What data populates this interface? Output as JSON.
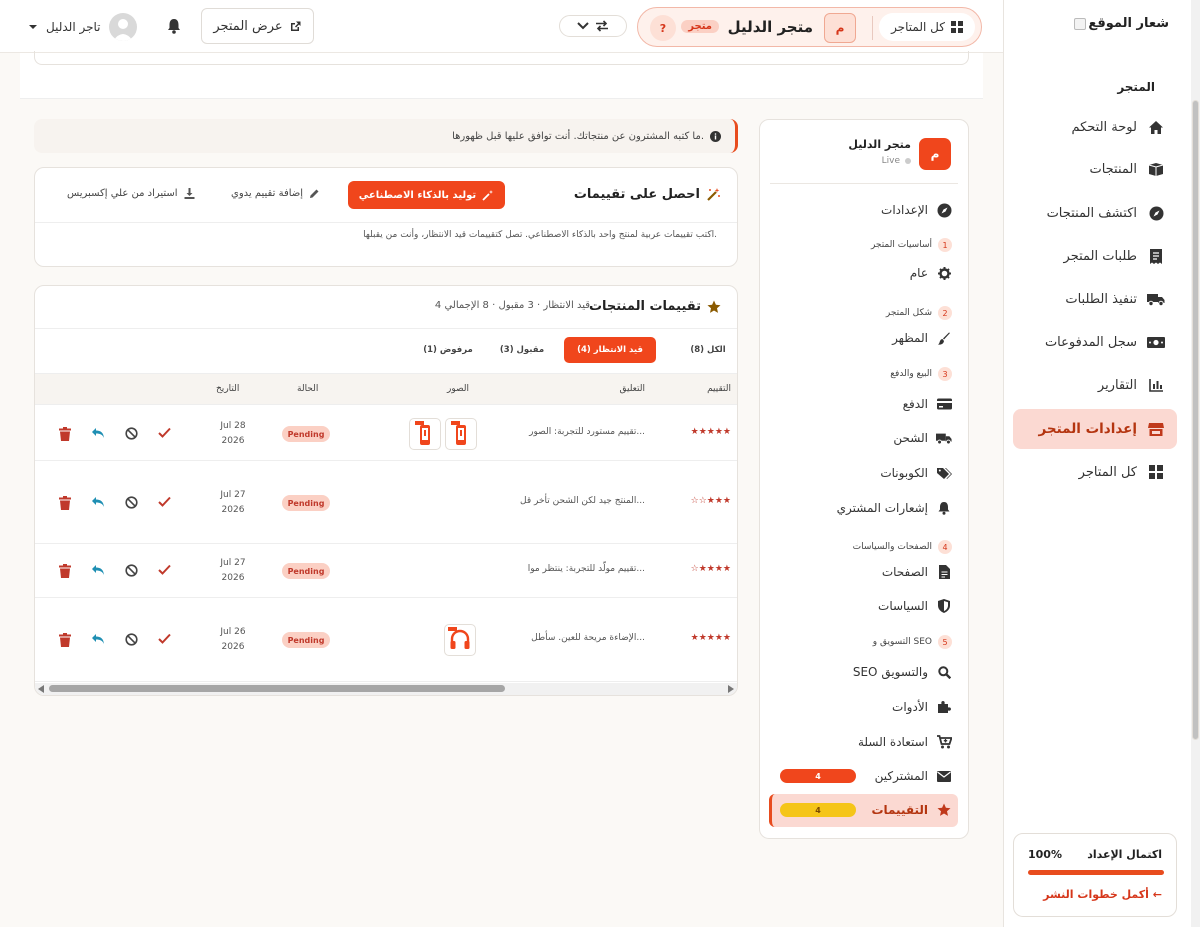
{
  "logo": {
    "text": "شعار الموقع"
  },
  "nav": {
    "section": "المتجر",
    "items": [
      {
        "label": "لوحة التحكم",
        "icon": "home-icon"
      },
      {
        "label": "المنتجات",
        "icon": "box-icon"
      },
      {
        "label": "اكتشف المنتجات",
        "icon": "compass-icon"
      },
      {
        "label": "طلبات المتجر",
        "icon": "receipt-icon"
      },
      {
        "label": "تنفيذ الطلبات",
        "icon": "truck-icon"
      },
      {
        "label": "سجل المدفوعات",
        "icon": "money-icon"
      },
      {
        "label": "التقارير",
        "icon": "chart-icon"
      },
      {
        "label": "إعدادات المتجر",
        "icon": "store-icon"
      },
      {
        "label": "كل المتاجر",
        "icon": "grid-icon"
      }
    ],
    "active_index": 7
  },
  "setup": {
    "title": "اكتمال الإعداد",
    "percent": "100%",
    "progress": 1.0,
    "link": "أكمل خطوات النشر ←"
  },
  "topbar": {
    "user_name": "تاجر الدليل",
    "view_store": "عرض المتجر",
    "all_stores": "كل المتاجر",
    "store_initial": "م",
    "store_name": "متجر الدليل",
    "store_badge": "متجر",
    "help": "?"
  },
  "settings_panel": {
    "store_initial": "م",
    "store_name": "متجر الدليل",
    "status": "Live",
    "items": [
      {
        "type": "item",
        "label": "الإعدادات",
        "icon": "compass-icon"
      },
      {
        "type": "group",
        "num": "1",
        "label": "أساسيات المتجر"
      },
      {
        "type": "item",
        "label": "عام",
        "icon": "gear-icon"
      },
      {
        "type": "group",
        "num": "2",
        "label": "شكل المتجر"
      },
      {
        "type": "item",
        "label": "المظهر",
        "icon": "brush-icon"
      },
      {
        "type": "group",
        "num": "3",
        "label": "البيع والدفع"
      },
      {
        "type": "item",
        "label": "الدفع",
        "icon": "card-icon"
      },
      {
        "type": "item",
        "label": "الشحن",
        "icon": "truck-icon"
      },
      {
        "type": "item",
        "label": "الكوبونات",
        "icon": "tags-icon"
      },
      {
        "type": "item",
        "label": "إشعارات المشتري",
        "icon": "bell-icon"
      },
      {
        "type": "group",
        "num": "4",
        "label": "الصفحات والسياسات"
      },
      {
        "type": "item",
        "label": "الصفحات",
        "icon": "file-icon"
      },
      {
        "type": "item",
        "label": "السياسات",
        "icon": "shield-icon"
      },
      {
        "type": "group",
        "num": "5",
        "label": "التسويق و SEO"
      },
      {
        "type": "item",
        "label": "SEO والتسويق",
        "icon": "search-icon"
      },
      {
        "type": "item",
        "label": "الأدوات",
        "icon": "puzzle-icon"
      },
      {
        "type": "item",
        "label": "استعادة السلة",
        "icon": "cart-icon"
      },
      {
        "type": "item",
        "label": "المشتركين",
        "icon": "envelope-icon",
        "count": "4"
      },
      {
        "type": "item",
        "label": "التقييمات",
        "icon": "star-icon",
        "count": "4",
        "active": true
      }
    ]
  },
  "notice": {
    "text": "ما كتبه المشترون عن منتجاتك. أنت توافق عليها قبل ظهورها."
  },
  "generate": {
    "title": "احصل على تقييمات",
    "ai_button": "توليد بالذكاء الاصطناعي",
    "manual_button": "إضافة تقييم يدوي",
    "import_button": "استيراد من علي إكسبريس",
    "description": "اكتب تقييمات عربية لمنتج واحد بالذكاء الاصطناعي. تصل كتقييمات قيد الانتظار، وأنت من يقبلها."
  },
  "reviews": {
    "title": "تقييمات المنتجات",
    "stats": "4 قيد الانتظار · 3 مقبول · 8 الإجمالي",
    "tabs": [
      {
        "label": "الكل (8)"
      },
      {
        "label": "قيد الانتظار (4)",
        "active": true
      },
      {
        "label": "مقبول (3)"
      },
      {
        "label": "مرفوض (1)"
      }
    ],
    "columns": {
      "rating": "التقييم",
      "comment": "التعليق",
      "images": "الصور",
      "status": "الحالة",
      "date": "التاريخ"
    },
    "rows": [
      {
        "stars": "★★★★★",
        "comment": "تقييم مستورد للتجربة: الصور...",
        "images": 2,
        "status": "Pending",
        "date_day": "Jul 28",
        "date_year": "2026"
      },
      {
        "stars": "☆☆★★★",
        "comment": "المنتج جيد لكن الشحن تأخر قل...",
        "images": 0,
        "status": "Pending",
        "date_day": "Jul 27",
        "date_year": "2026"
      },
      {
        "stars": "☆★★★★",
        "comment": "تقييم مولّد للتجربة: ينتظر موا...",
        "images": 0,
        "status": "Pending",
        "date_day": "Jul 27",
        "date_year": "2026"
      },
      {
        "stars": "★★★★★",
        "comment": "الإضاءة مريحة للعين. سأطل...",
        "images": 1,
        "status": "Pending",
        "date_day": "Jul 26",
        "date_year": "2026"
      }
    ]
  },
  "colors": {
    "accent": "#f0461c",
    "accent_soft": "#fbd9d2",
    "pending": "#fbd0c4",
    "count_bar": "#f0461c",
    "count_bar_active": "#f5c518"
  }
}
